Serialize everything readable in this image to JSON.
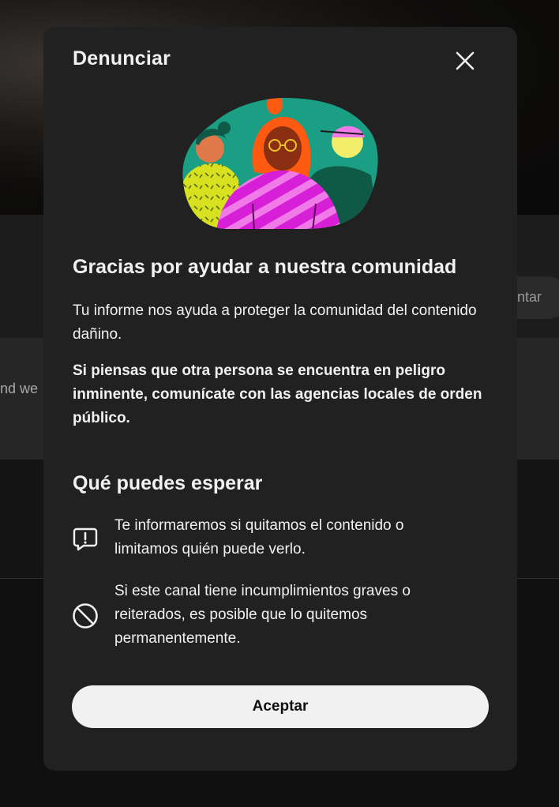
{
  "background": {
    "side_button_label": "ntar",
    "side_text": "nd we"
  },
  "dialog": {
    "title": "Denunciar",
    "close_icon": "close-icon",
    "illustration": "community-people-illustration",
    "heading": "Gracias por ayudar a nuestra comunidad",
    "paragraph": "Tu informe nos ayuda a proteger la comunidad del contenido dañino.",
    "warning": "Si piensas que otra persona se encuentra en peligro inminente, comunícate con las agencias locales de orden público.",
    "expect_heading": "Qué puedes esperar",
    "expect_items": [
      {
        "icon": "report-alert-icon",
        "text": "Te informaremos si quitamos el contenido o limitamos quién puede verlo."
      },
      {
        "icon": "block-icon",
        "text": "Si este canal tiene incumplimientos graves o reiterados, es posible que lo quitemos permanentemente."
      }
    ],
    "accept_label": "Aceptar"
  },
  "colors": {
    "dialog_bg": "#212121",
    "text": "#f1f1f1",
    "button_bg": "#f1f1f1",
    "illustration_teal": "#1a9e84",
    "illustration_magenta": "#d61fd6",
    "illustration_orange": "#ff5a12",
    "illustration_yellow": "#d8e11f"
  }
}
